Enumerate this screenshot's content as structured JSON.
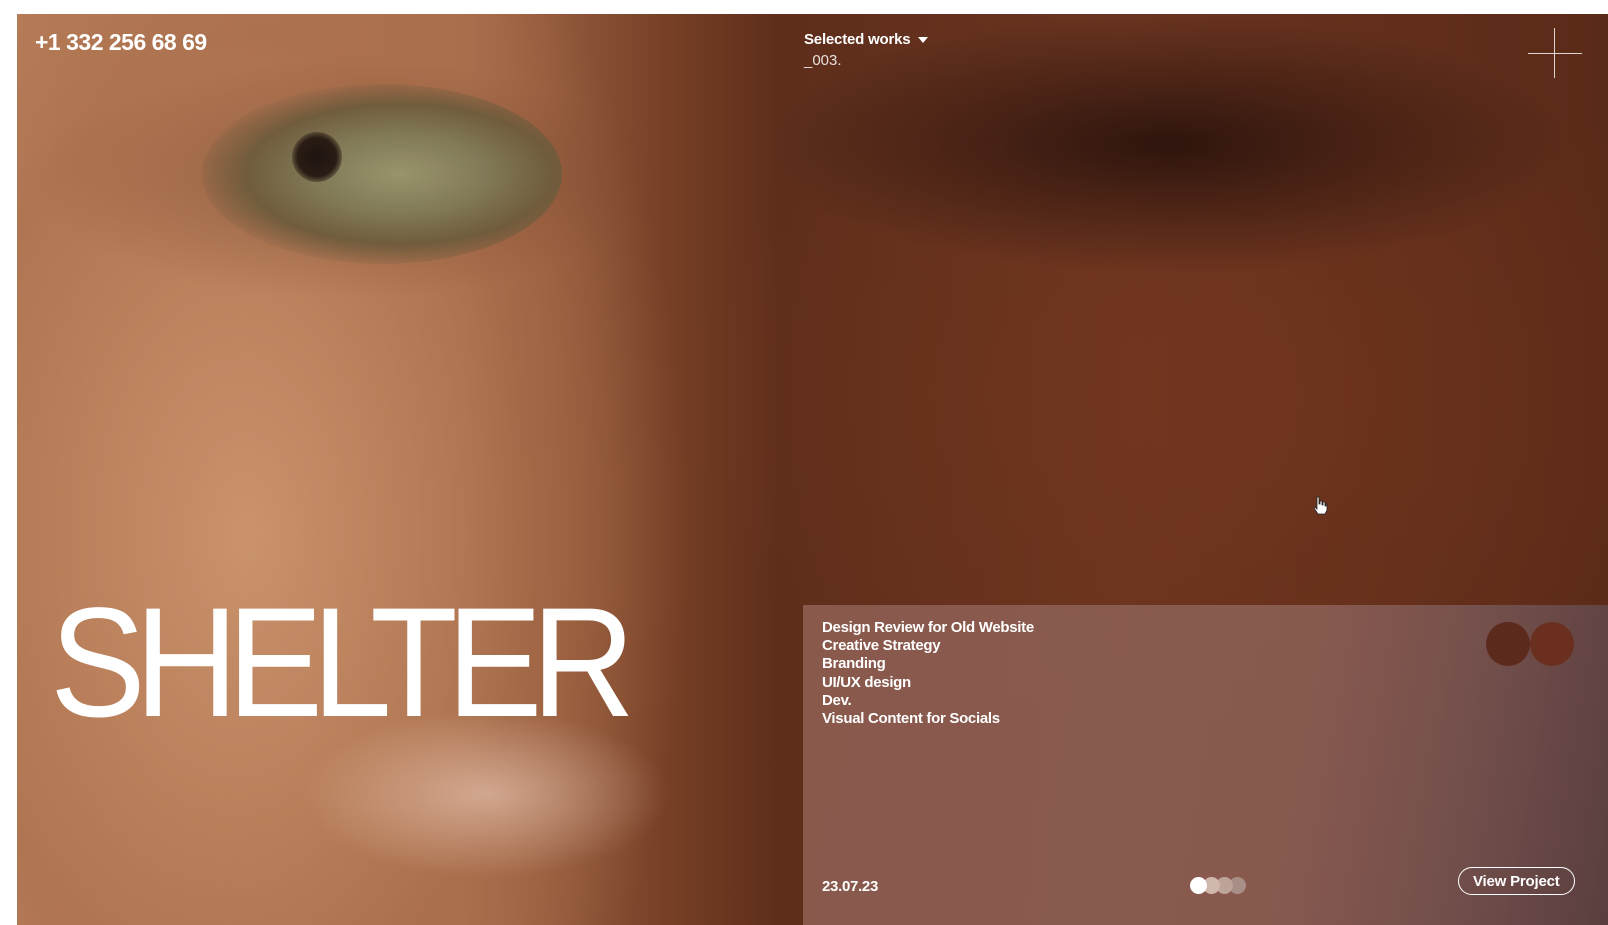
{
  "header": {
    "phone": "+1 332 256 68 69",
    "selected_works_label": "Selected works",
    "project_number": "_003."
  },
  "project": {
    "title": "SHELTER",
    "services": [
      "Design Review for Old Website",
      "Creative Strategy",
      "Branding",
      "UI/UX design",
      "Dev.",
      "Visual Content for Socials"
    ],
    "date": "23.07.23",
    "view_button_label": "View Project",
    "slide_count": 4,
    "active_slide": 1
  },
  "icons": {
    "menu": "plus-icon",
    "dropdown": "caret-down-icon",
    "cursor": "hand-pointer-icon"
  },
  "colors": {
    "text": "#ffffff",
    "panel": "#8c5c50",
    "thumb": "#5c2a1c"
  }
}
